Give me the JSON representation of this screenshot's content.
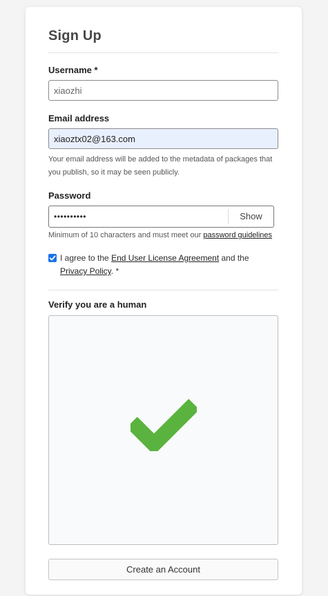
{
  "form": {
    "title": "Sign Up",
    "username": {
      "label": "Username *",
      "value": "xiaozhi"
    },
    "email": {
      "label": "Email address",
      "value": "xiaoztx02@163.com",
      "help": "Your email address will be added to the metadata of packages that you publish, so it may be seen publicly."
    },
    "password": {
      "label": "Password",
      "masked_value": "••••••••••",
      "show_label": "Show",
      "help_prefix": "Minimum of 10 characters and must meet our ",
      "help_link": "password guidelines"
    },
    "agreement": {
      "checked": true,
      "prefix": "I agree to the ",
      "eula_link": "End User License Agreement",
      "middle": " and the ",
      "privacy_link": "Privacy Policy",
      "suffix": ". *"
    },
    "captcha": {
      "label": "Verify you are a human",
      "icon": "checkmark-icon",
      "color": "#5ab33e"
    },
    "submit_label": "Create an Account"
  }
}
